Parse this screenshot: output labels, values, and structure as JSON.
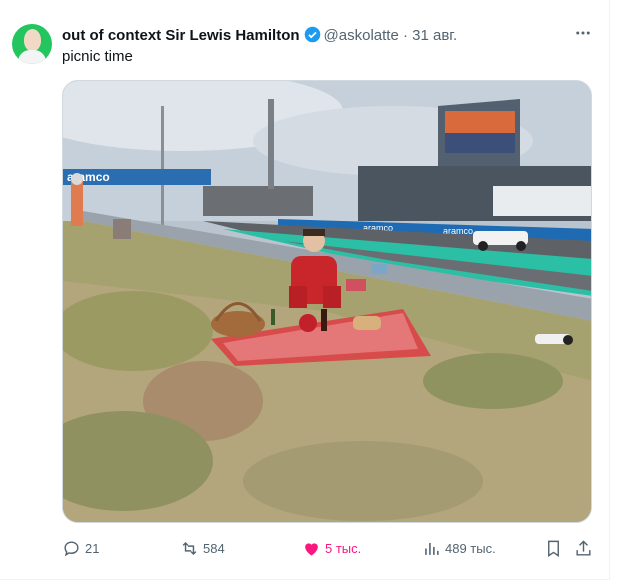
{
  "tweet": {
    "display_name": "out of context Sir Lewis Hamilton",
    "handle": "@askolatte",
    "dot": "·",
    "date": "31 авг.",
    "text": "picnic time",
    "more_icon": "more-dots-icon",
    "verified_icon": "verified-badge-icon"
  },
  "media": {
    "banner_text": "aramco"
  },
  "actions": {
    "replies": "21",
    "reposts": "584",
    "likes": "5 тыс.",
    "views": "489 тыс.",
    "like_color": "#f91880",
    "muted_color": "#536471"
  }
}
